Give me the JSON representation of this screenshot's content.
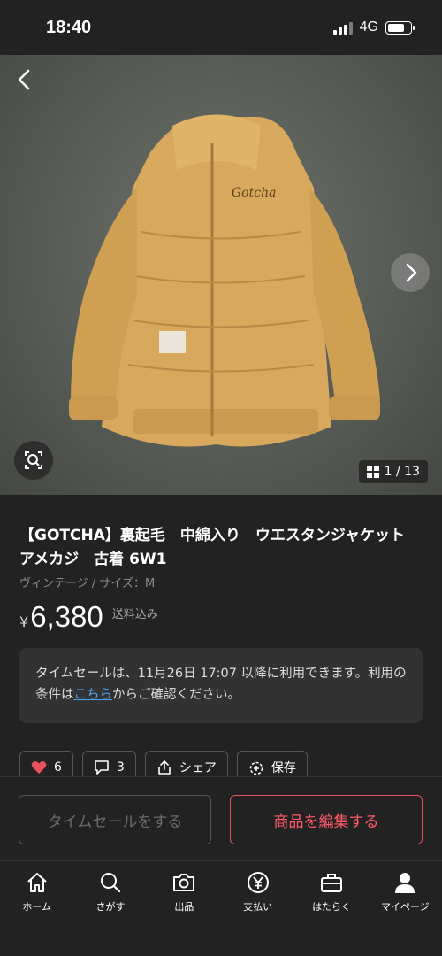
{
  "status": {
    "time": "18:40",
    "network": "4G"
  },
  "gallery": {
    "current": 1,
    "total": 13,
    "counter_text": "1 / 13"
  },
  "product": {
    "title": "【GOTCHA】裏起毛　中綿入り　ウエスタンジャケット　アメカジ　古着 6W1",
    "subtitle": "ヴィンテージ / サイズ：M",
    "price_symbol": "¥",
    "price": "6,380",
    "price_note": "送料込み"
  },
  "notice": {
    "text_before": "タイムセールは、11月26日 17:07 以降に利用できます。利用の条件は",
    "link": "こちら",
    "text_after": "からご確認ください。"
  },
  "actions": {
    "like_count": "6",
    "comment_count": "3",
    "share_label": "シェア",
    "save_label": "保存"
  },
  "buttons": {
    "timesale_label": "タイムセールをする",
    "edit_label": "商品を編集する"
  },
  "tabs": [
    {
      "label": "ホーム",
      "icon": "home-icon"
    },
    {
      "label": "さがす",
      "icon": "search-icon"
    },
    {
      "label": "出品",
      "icon": "camera-icon"
    },
    {
      "label": "支払い",
      "icon": "yen-icon"
    },
    {
      "label": "はたらく",
      "icon": "briefcase-icon"
    },
    {
      "label": "マイページ",
      "icon": "person-icon"
    }
  ],
  "colors": {
    "background": "#222222",
    "accent": "#e8505b",
    "link": "#4ea3f0",
    "like": "#e8505b"
  }
}
